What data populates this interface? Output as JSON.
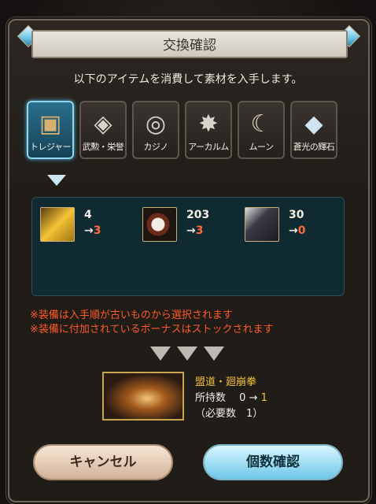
{
  "dialog": {
    "title": "交換確認",
    "instruction": "以下のアイテムを消費して素材を入手します。"
  },
  "categories": [
    {
      "label": "トレジャー",
      "icon": "treasure-chest-icon",
      "active": true
    },
    {
      "label": "武勲・栄誉",
      "icon": "crystal-icon",
      "active": false
    },
    {
      "label": "カジノ",
      "icon": "casino-chip-icon",
      "active": false
    },
    {
      "label": "アーカルム",
      "icon": "arcarum-icon",
      "active": false
    },
    {
      "label": "ムーン",
      "icon": "moon-icon",
      "active": false
    },
    {
      "label": "蒼光の輝石",
      "icon": "shining-stone-icon",
      "active": false
    }
  ],
  "consumed_items": [
    {
      "icon": "gold-bar-icon",
      "owned": "4",
      "after": "3"
    },
    {
      "icon": "casino-item-icon",
      "owned": "203",
      "after": "3"
    },
    {
      "icon": "gauntlet-icon",
      "owned": "30",
      "after": "0"
    }
  ],
  "notes": [
    "※装備は入手順が古いものから選択されます",
    "※装備に付加されているボーナスはストックされます"
  ],
  "reward": {
    "name": "盟道・廻崩拳",
    "owned_label": "所持数",
    "owned_from": "0",
    "owned_to": "1",
    "need_text": "（必要数　1）"
  },
  "buttons": {
    "cancel": "キャンセル",
    "confirm": "個数確認"
  },
  "colors": {
    "accent_blue": "#6ec7e8",
    "decrease_red": "#ff6a3a",
    "gold_text": "#f5c236"
  }
}
